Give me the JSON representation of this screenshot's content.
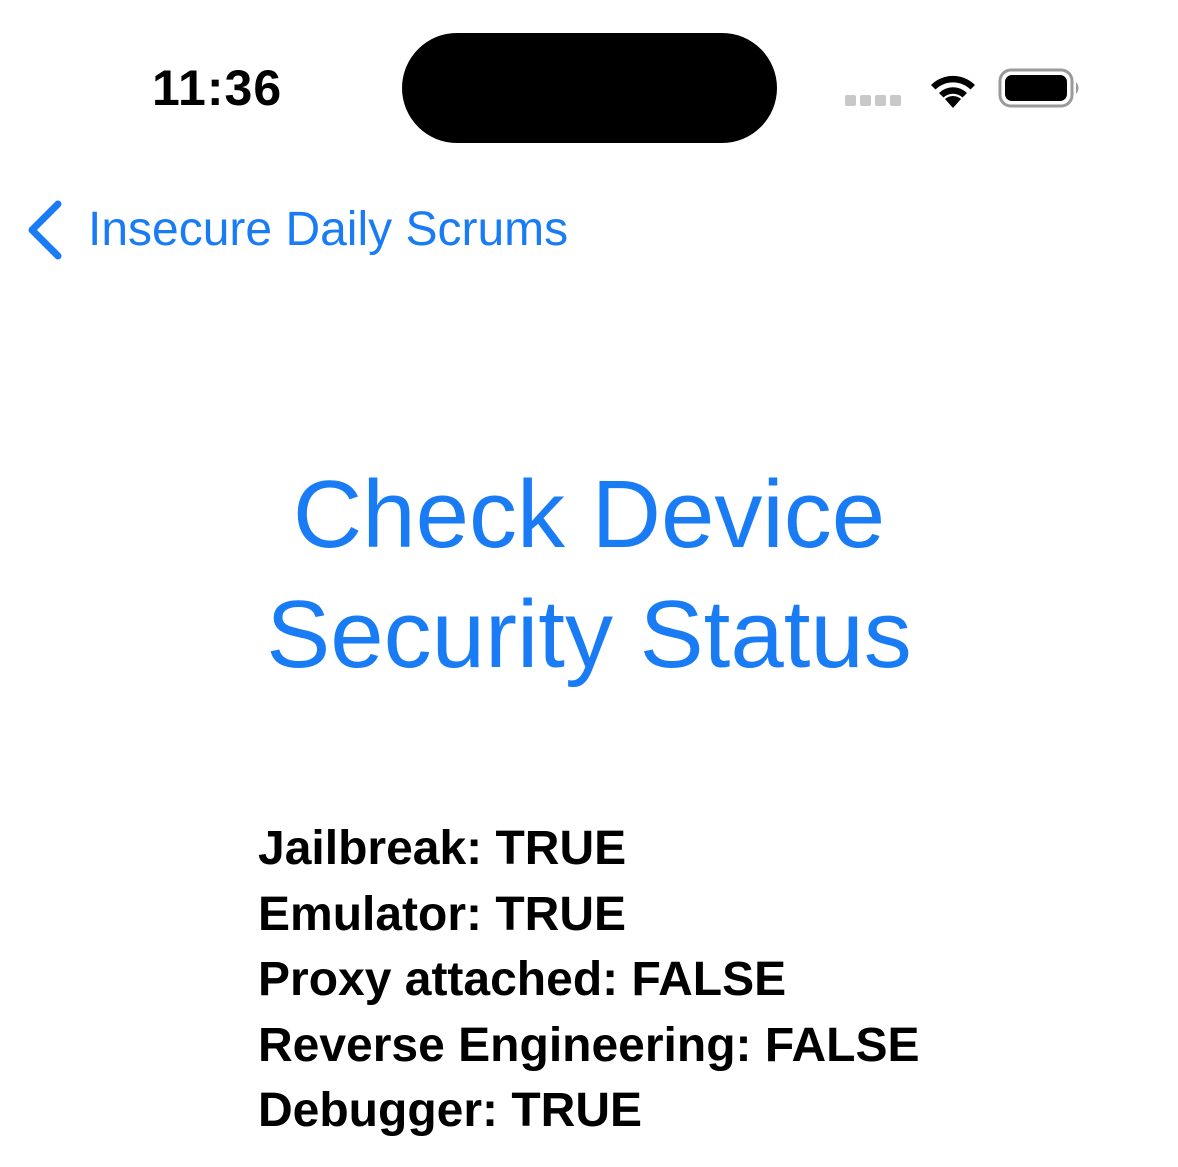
{
  "status_bar": {
    "time": "11:36",
    "icons": [
      "signal-icon",
      "wifi-icon",
      "battery-icon"
    ]
  },
  "nav": {
    "back_label": "Insecure Daily Scrums",
    "back_icon": "chevron-left-icon"
  },
  "title": {
    "line1": "Check Device",
    "line2": "Security Status"
  },
  "checks": [
    {
      "label": "Jailbreak",
      "value": "TRUE",
      "text": "Jailbreak: TRUE"
    },
    {
      "label": "Emulator",
      "value": "TRUE",
      "text": "Emulator: TRUE"
    },
    {
      "label": "Proxy attached",
      "value": "FALSE",
      "text": "Proxy attached: FALSE"
    },
    {
      "label": "Reverse Engineering",
      "value": "FALSE",
      "text": "Reverse Engineering: FALSE"
    },
    {
      "label": "Debugger",
      "value": "TRUE",
      "text": "Debugger: TRUE"
    }
  ],
  "colors": {
    "accent": "#1a7cf5",
    "text": "#000000",
    "background": "#ffffff"
  }
}
